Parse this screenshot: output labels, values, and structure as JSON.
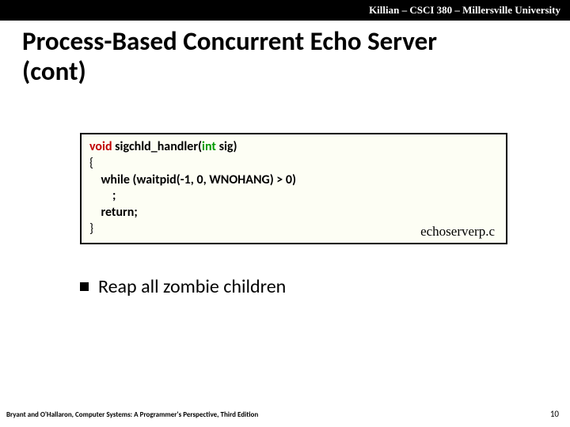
{
  "header": {
    "course_line": "Killian – CSCI 380 – Millersville University"
  },
  "title": {
    "line1": "Process-Based Concurrent Echo Server",
    "line2": " (cont)"
  },
  "code": {
    "kw_void": "void",
    "fn_name": " sigchld_handler(",
    "kw_int": "int",
    "param_after": " sig)",
    "brace_open": "{",
    "kw_while": "    while",
    "while_rest": " (waitpid(-1, 0, WNOHANG) > 0)",
    "semi_line": "        ;",
    "kw_return_indent": "    ",
    "kw_return": "return",
    "return_semi": ";",
    "brace_close": "}",
    "filename": "echoserverp.c"
  },
  "bullet": {
    "text": "Reap all zombie children"
  },
  "footer": {
    "left": "Bryant and O'Hallaron, Computer Systems: A Programmer's Perspective, Third Edition",
    "page": "10"
  }
}
